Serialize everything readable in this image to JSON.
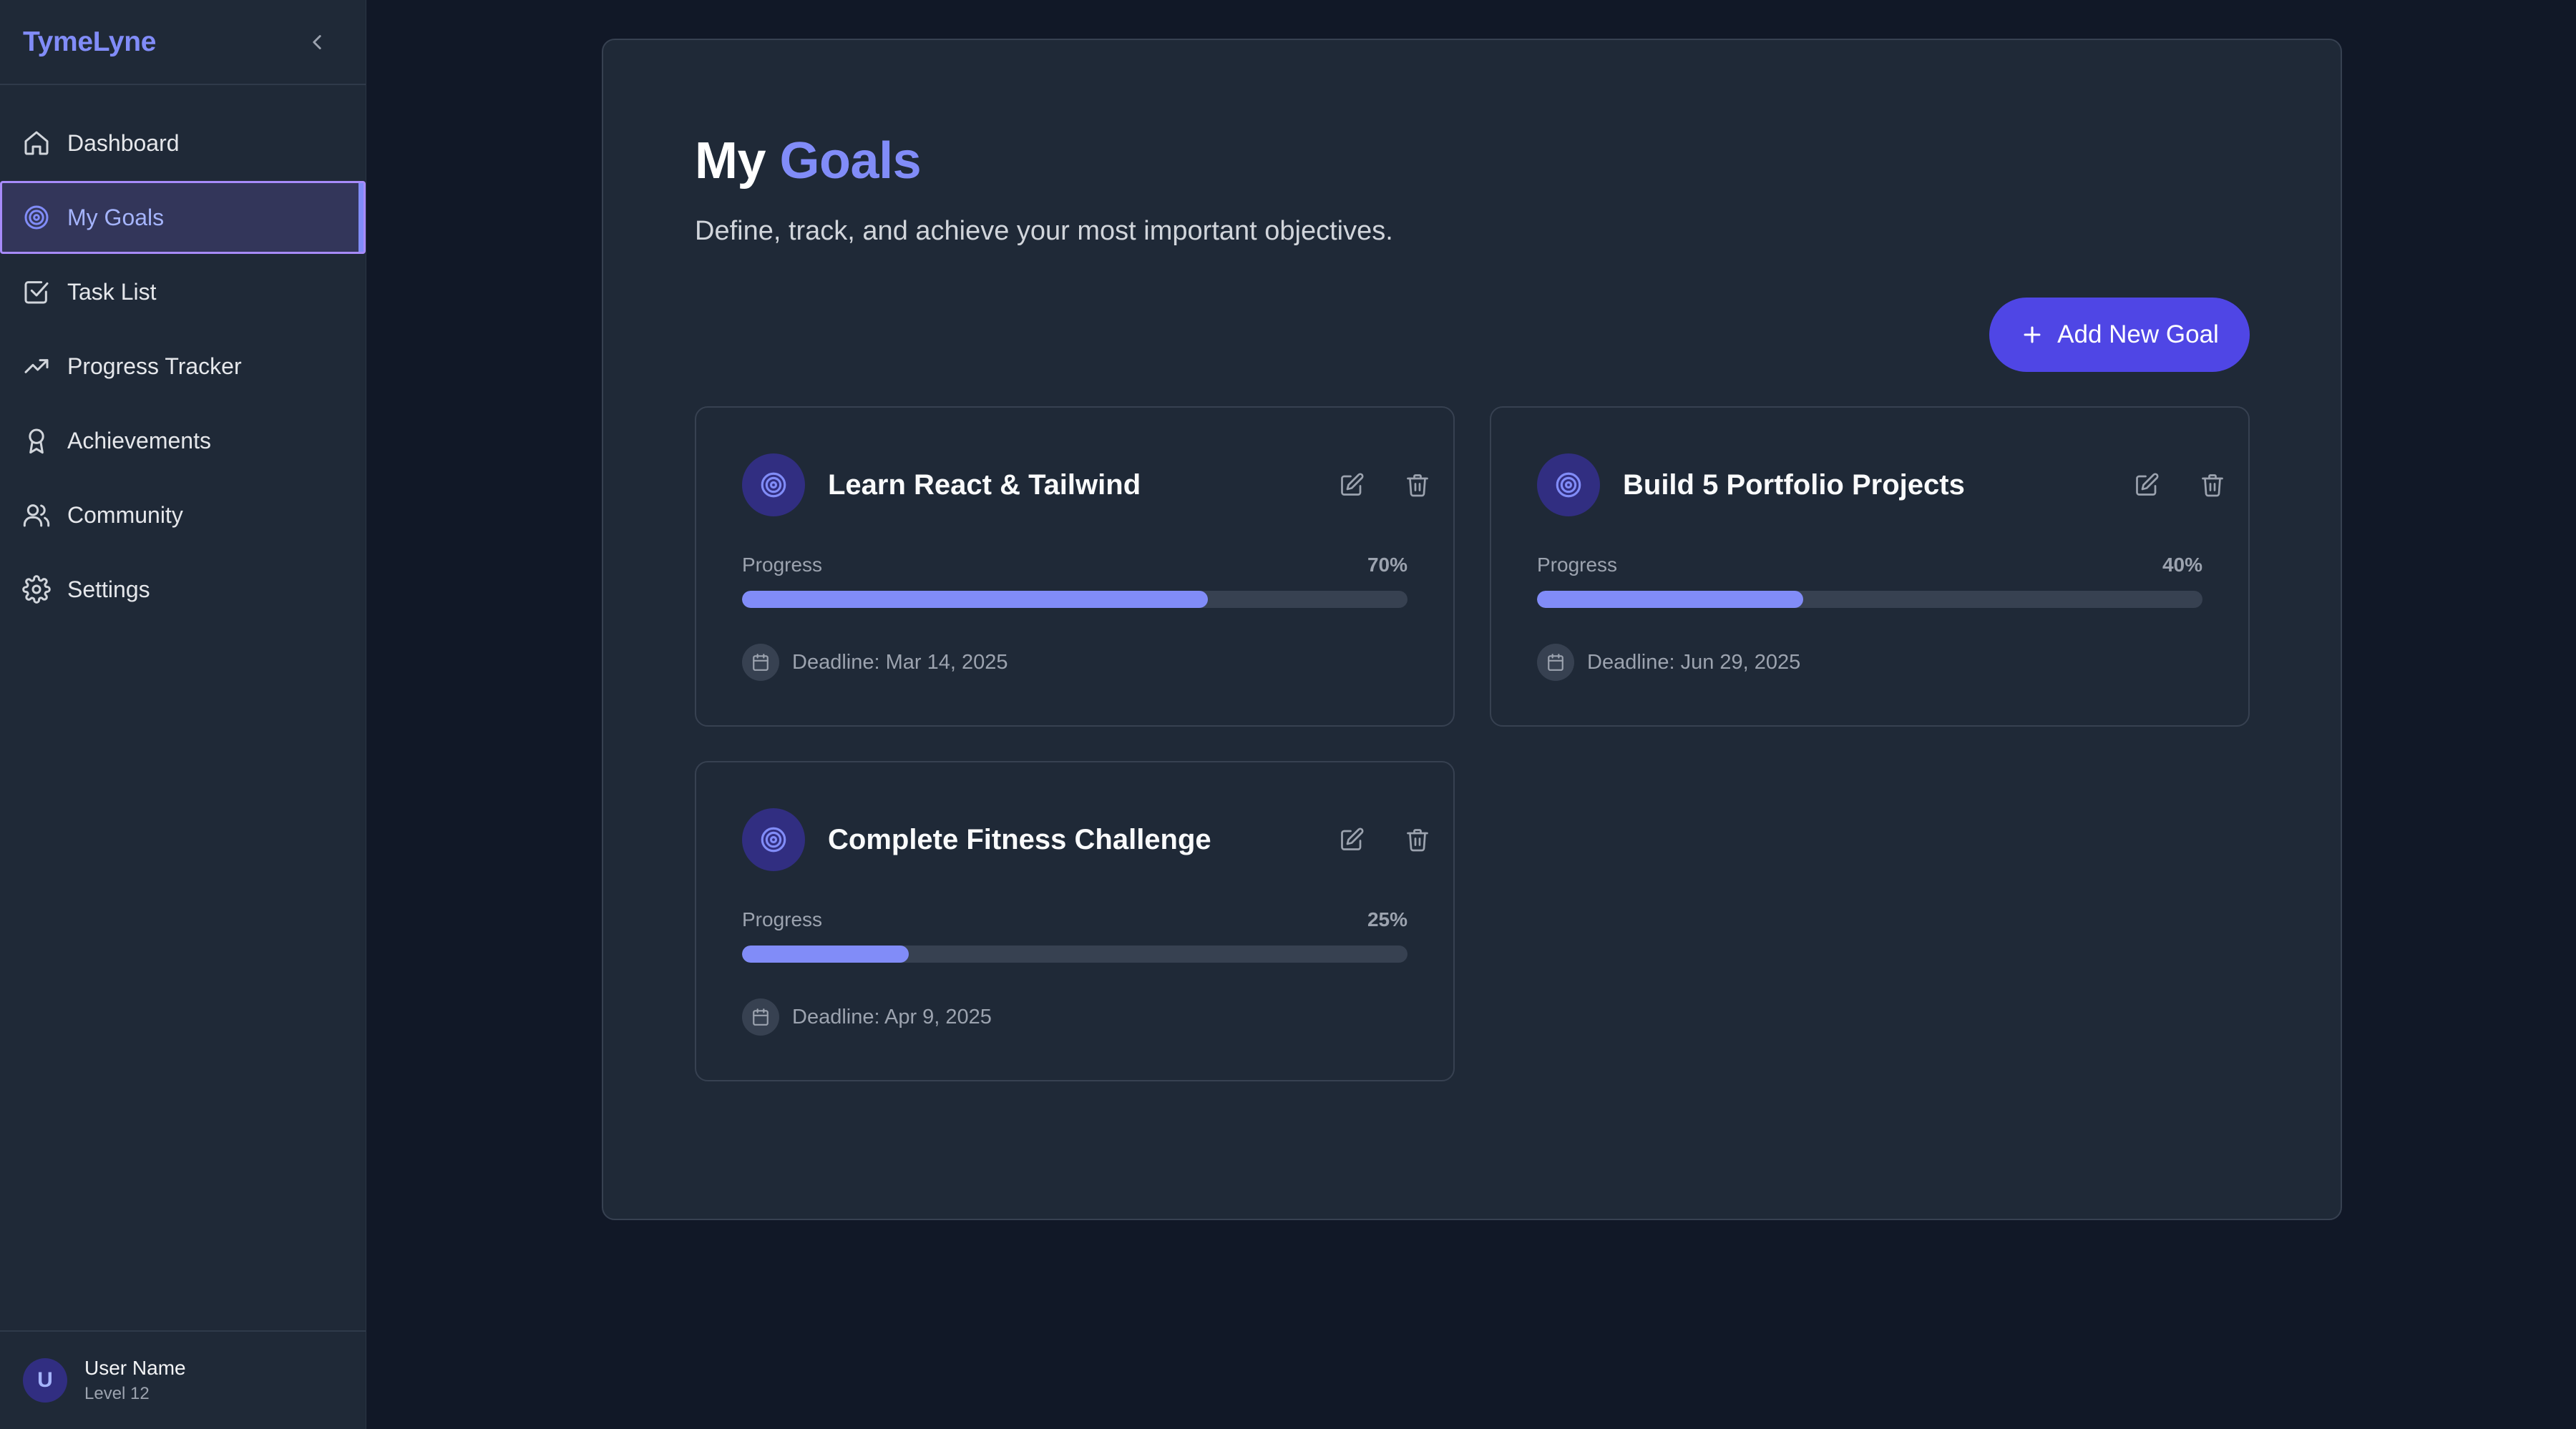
{
  "app": {
    "brand": "TymeLyne"
  },
  "sidebar": {
    "items": [
      {
        "label": "Dashboard",
        "icon": "home-icon",
        "active": false
      },
      {
        "label": "My Goals",
        "icon": "target-icon",
        "active": true
      },
      {
        "label": "Task List",
        "icon": "check-square-icon",
        "active": false
      },
      {
        "label": "Progress Tracker",
        "icon": "trending-up-icon",
        "active": false
      },
      {
        "label": "Achievements",
        "icon": "award-icon",
        "active": false
      },
      {
        "label": "Community",
        "icon": "users-icon",
        "active": false
      },
      {
        "label": "Settings",
        "icon": "gear-icon",
        "active": false
      }
    ],
    "user": {
      "initial": "U",
      "name": "User Name",
      "level": "Level 12"
    }
  },
  "main": {
    "title_prefix": "My",
    "title_accent": "Goals",
    "subtitle": "Define, track, and achieve your most important objectives.",
    "add_button_label": "Add New Goal",
    "progress_label": "Progress",
    "goals": [
      {
        "title": "Learn React & Tailwind",
        "progress": 70,
        "progress_text": "70%",
        "deadline": "Deadline: Mar 14, 2025"
      },
      {
        "title": "Build 5 Portfolio Projects",
        "progress": 40,
        "progress_text": "40%",
        "deadline": "Deadline: Jun 29, 2025"
      },
      {
        "title": "Complete Fitness Challenge",
        "progress": 25,
        "progress_text": "25%",
        "deadline": "Deadline: Apr 9, 2025"
      }
    ]
  },
  "colors": {
    "accent": "#818cf8",
    "button": "#4f46e5",
    "background": "#111827",
    "surface": "#1f2937"
  }
}
